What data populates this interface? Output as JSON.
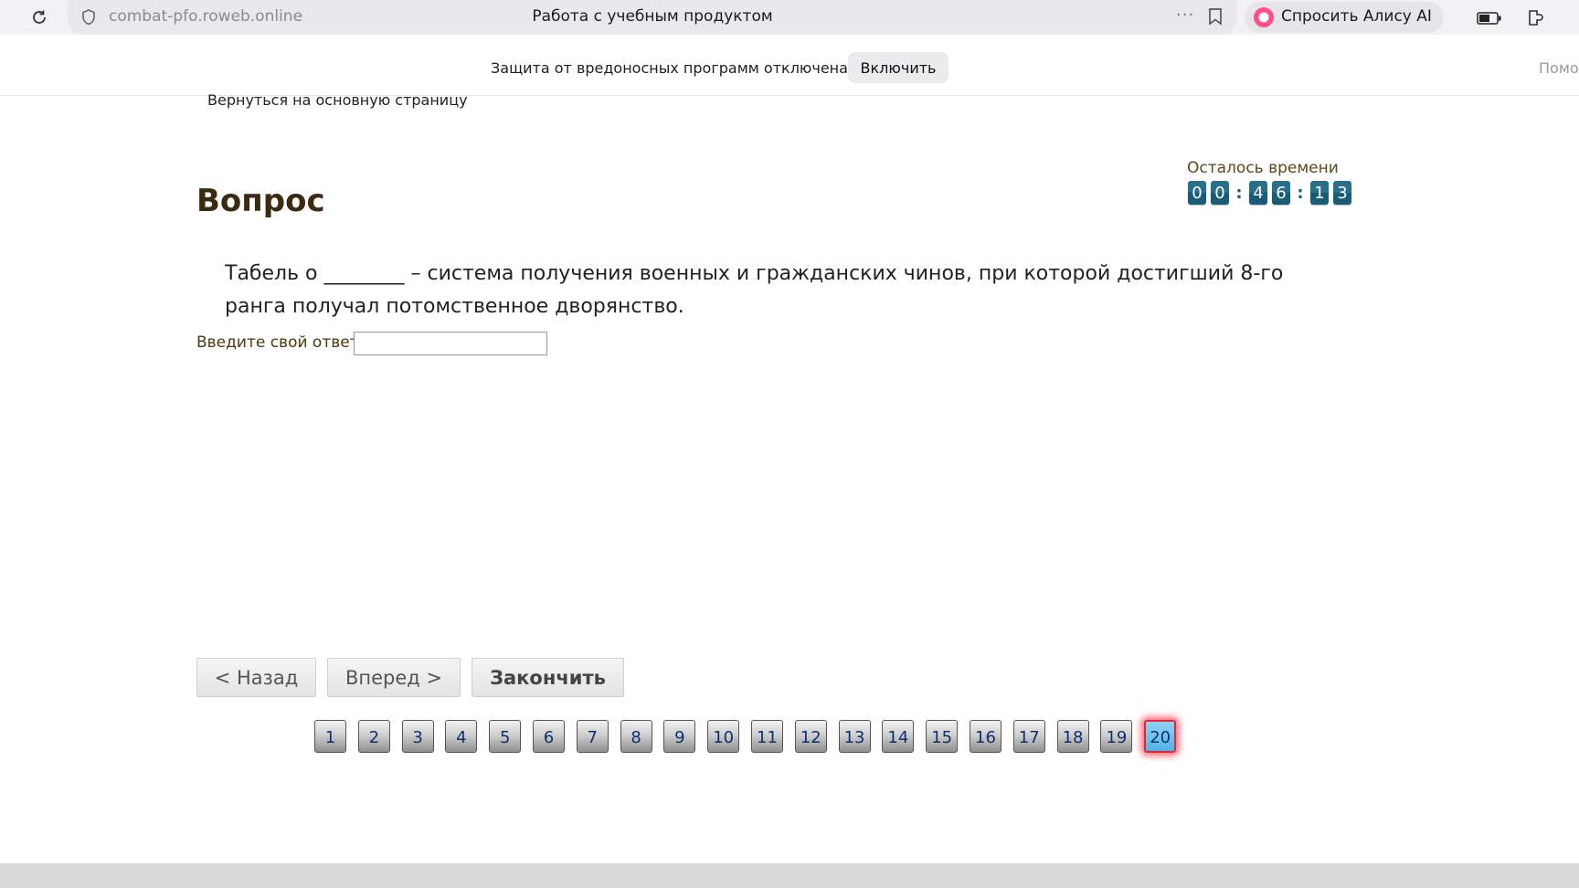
{
  "browser": {
    "url": "combat-pfo.roweb.online",
    "tab_title": "Работа с учебным продуктом",
    "more": "···",
    "alice_label": "Спросить Алису AI"
  },
  "notice": {
    "text": "Защита от вредоносных программ отключена",
    "enable_label": "Включить",
    "help_label": "Помо"
  },
  "page": {
    "back_link": "Вернуться на основную страницу",
    "title": "Вопрос",
    "timer_label": "Осталось времени",
    "timer_digits": [
      "0",
      "0",
      "4",
      "6",
      "1",
      "3"
    ],
    "timer_sep": ":",
    "question": "Табель о ________ – система получения военных и гражданских чинов, при которой достигший 8-го ранга получал потомственное дворянство.",
    "answer_label": "Введите свой ответ",
    "answer_value": ""
  },
  "navigation": {
    "back_label": "< Назад",
    "next_label": "Вперед >",
    "finish_label": "Закончить"
  },
  "pager": {
    "pages": [
      "1",
      "2",
      "3",
      "4",
      "5",
      "6",
      "7",
      "8",
      "9",
      "10",
      "11",
      "12",
      "13",
      "14",
      "15",
      "16",
      "17",
      "18",
      "19",
      "20"
    ],
    "current": "20"
  },
  "colors": {
    "title": "#3a2a10",
    "timer_digit": "#1a5b76",
    "active_page": "#4fb4e6"
  }
}
